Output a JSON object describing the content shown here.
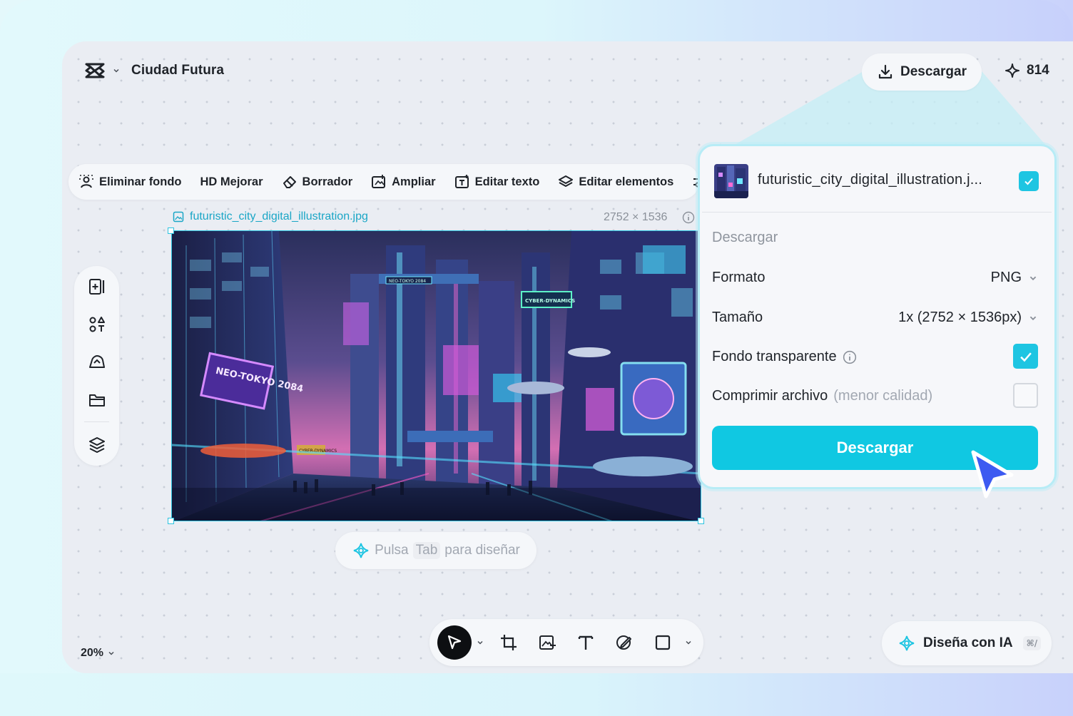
{
  "header": {
    "project_title": "Ciudad Futura",
    "download_label": "Descargar",
    "credits": "814"
  },
  "toolbar": {
    "items": [
      {
        "label": "Eliminar fondo",
        "icon": "remove-background-icon"
      },
      {
        "label": "HD Mejorar",
        "icon": "hd-enhance-icon"
      },
      {
        "label": "Borrador",
        "icon": "eraser-icon"
      },
      {
        "label": "Ampliar",
        "icon": "expand-icon"
      },
      {
        "label": "Editar texto",
        "icon": "edit-text-icon"
      },
      {
        "label": "Editar elementos",
        "icon": "layers-icon"
      }
    ],
    "settings_icon": "sliders-icon"
  },
  "image": {
    "file_name": "futuristic_city_digital_illustration.jpg",
    "dimensions": "2752 × 1536",
    "signs": [
      "NEO-TOKYO 2084",
      "NEO-TOKYO 2084",
      "CYBER-DYNAMICS",
      "CYBER-DYNAMICS"
    ]
  },
  "hint": {
    "prefix": "Pulsa",
    "key": "Tab",
    "suffix": "para diseñar"
  },
  "left_panel": {
    "items": [
      "add-media-icon",
      "elements-icon",
      "cloud-upload-icon",
      "folder-icon",
      "layers-stack-icon"
    ]
  },
  "zoom": "20%",
  "bottom_toolbar": {
    "tools": [
      "select-arrow-icon",
      "crop-icon",
      "add-image-icon",
      "text-tool-icon",
      "draw-icon",
      "rectangle-icon"
    ]
  },
  "design_ai": {
    "label": "Diseña con IA",
    "shortcut": "⌘/"
  },
  "download_panel": {
    "file_name": "futuristic_city_digital_illustration.j...",
    "section_title": "Descargar",
    "format_label": "Formato",
    "format_value": "PNG",
    "size_label": "Tamaño",
    "size_value": "1x (2752 × 1536px)",
    "transparent_label": "Fondo transparente",
    "transparent_checked": true,
    "compress_label": "Comprimir archivo",
    "compress_note": "(menor calidad)",
    "compress_checked": false,
    "button_label": "Descargar"
  },
  "colors": {
    "accent": "#10c8e2",
    "link": "#1aa6c6",
    "canvas": "#eaedf3",
    "cursor": "#3d5af1"
  }
}
